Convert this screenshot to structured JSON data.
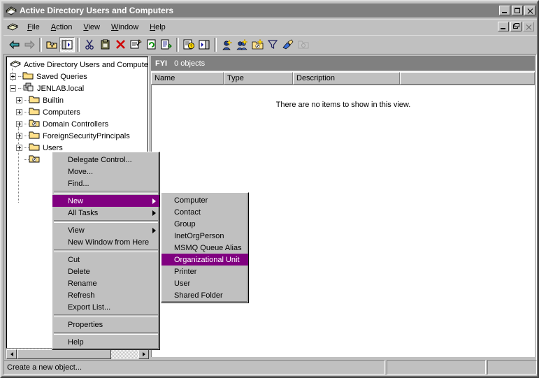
{
  "window": {
    "title": "Active Directory Users and Computers",
    "icon": "console-icon",
    "buttons": {
      "minimize": "_",
      "maximize": "□",
      "close": "✕"
    }
  },
  "menubar": {
    "icon": "console-icon",
    "items": [
      {
        "label": "File",
        "accel": "F"
      },
      {
        "label": "Action",
        "accel": "A"
      },
      {
        "label": "View",
        "accel": "V"
      },
      {
        "label": "Window",
        "accel": "W"
      },
      {
        "label": "Help",
        "accel": "H"
      }
    ],
    "child_buttons": {
      "minimize": "_",
      "restore": "❐",
      "close": "✕"
    }
  },
  "toolbar": {
    "items": [
      {
        "name": "back-icon",
        "label": "Back"
      },
      {
        "name": "forward-icon",
        "label": "Forward"
      },
      {
        "name": "up-one-level-icon",
        "label": "Up One Level"
      },
      {
        "name": "show-hide-tree-icon",
        "label": "Show/Hide Console Tree",
        "pressed": true
      },
      {
        "name": "cut-icon",
        "label": "Cut"
      },
      {
        "name": "paste-icon",
        "label": "Paste"
      },
      {
        "name": "delete-icon",
        "label": "Delete"
      },
      {
        "name": "properties-icon",
        "label": "Properties"
      },
      {
        "name": "refresh-icon",
        "label": "Refresh"
      },
      {
        "name": "export-list-icon",
        "label": "Export List"
      },
      {
        "name": "help-icon",
        "label": "Help"
      },
      {
        "name": "show-hide-console-icon",
        "label": "Show/Hide Action Pane"
      },
      {
        "name": "new-user-icon",
        "label": "New User"
      },
      {
        "name": "new-group-icon",
        "label": "New Group"
      },
      {
        "name": "new-ou-icon",
        "label": "New Organizational Unit"
      },
      {
        "name": "filter-icon",
        "label": "Filter"
      },
      {
        "name": "find-icon",
        "label": "Find"
      },
      {
        "name": "saved-query-icon",
        "label": "Saved Query"
      }
    ]
  },
  "tree": {
    "nodes": [
      {
        "label": "Active Directory Users and Computer",
        "icon": "console-root-icon",
        "indent": 0,
        "expander": "none"
      },
      {
        "label": "Saved Queries",
        "icon": "folder-icon",
        "indent": 1,
        "expander": "plus"
      },
      {
        "label": "JENLAB.local",
        "icon": "domain-icon",
        "indent": 1,
        "expander": "minus"
      },
      {
        "label": "Builtin",
        "icon": "folder-icon",
        "indent": 2,
        "expander": "plus"
      },
      {
        "label": "Computers",
        "icon": "folder-icon",
        "indent": 2,
        "expander": "plus"
      },
      {
        "label": "Domain Controllers",
        "icon": "ou-icon",
        "indent": 2,
        "expander": "plus"
      },
      {
        "label": "ForeignSecurityPrincipals",
        "icon": "folder-icon",
        "indent": 2,
        "expander": "plus"
      },
      {
        "label": "Users",
        "icon": "folder-icon",
        "indent": 2,
        "expander": "plus"
      },
      {
        "label": "",
        "icon": "ou-icon",
        "indent": 2,
        "expander": "none",
        "selected": true
      }
    ],
    "hscroll": {
      "left_arrow": "◀",
      "right_arrow": "▶"
    }
  },
  "listview": {
    "header_title": "FYI",
    "header_count": "0 objects",
    "columns": [
      "Name",
      "Type",
      "Description"
    ],
    "empty_message": "There are no items to show in this view.",
    "rows": []
  },
  "context_menu": {
    "items": [
      {
        "label": "Delegate Control...",
        "accel": "e",
        "type": "item"
      },
      {
        "label": "Move...",
        "accel": "v",
        "type": "item"
      },
      {
        "label": "Find...",
        "accel": "n",
        "type": "item"
      },
      {
        "type": "separator"
      },
      {
        "label": "New",
        "accel": "N",
        "type": "submenu",
        "selected": true
      },
      {
        "label": "All Tasks",
        "accel": "k",
        "type": "submenu"
      },
      {
        "type": "separator"
      },
      {
        "label": "View",
        "accel": "i",
        "type": "submenu"
      },
      {
        "label": "New Window from Here",
        "accel": "W",
        "type": "item"
      },
      {
        "type": "separator"
      },
      {
        "label": "Cut",
        "accel": "t",
        "type": "item"
      },
      {
        "label": "Delete",
        "accel": "D",
        "type": "item"
      },
      {
        "label": "Rename",
        "accel": "m",
        "type": "item"
      },
      {
        "label": "Refresh",
        "accel": "f",
        "type": "item"
      },
      {
        "label": "Export List...",
        "accel": "L",
        "type": "item"
      },
      {
        "type": "separator"
      },
      {
        "label": "Properties",
        "accel": "r",
        "type": "item"
      },
      {
        "type": "separator"
      },
      {
        "label": "Help",
        "accel": "H",
        "type": "item"
      }
    ]
  },
  "submenu": {
    "items": [
      {
        "label": "Computer"
      },
      {
        "label": "Contact"
      },
      {
        "label": "Group"
      },
      {
        "label": "InetOrgPerson"
      },
      {
        "label": "MSMQ Queue Alias"
      },
      {
        "label": "Organizational Unit",
        "selected": true
      },
      {
        "label": "Printer"
      },
      {
        "label": "User"
      },
      {
        "label": "Shared Folder"
      }
    ]
  },
  "statusbar": {
    "panels": [
      "Create a new object...",
      "",
      ""
    ]
  },
  "colors": {
    "highlight": "#800080",
    "titlebar": "#808080",
    "face": "#c0c0c0",
    "window": "#ffffff"
  }
}
